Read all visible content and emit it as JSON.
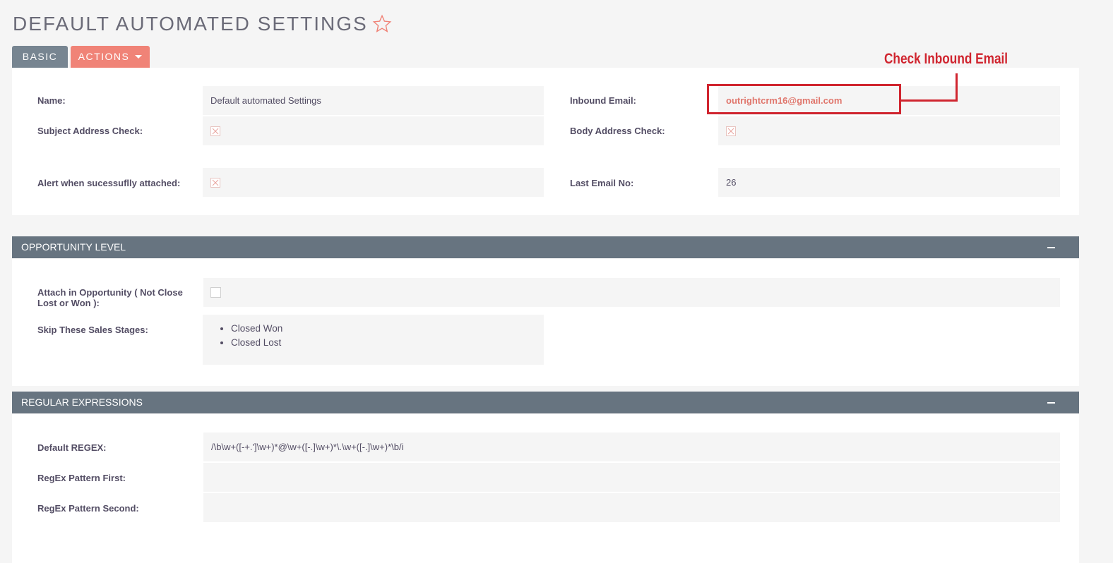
{
  "page": {
    "title": "DEFAULT AUTOMATED SETTINGS"
  },
  "tabs": {
    "basic": "BASIC",
    "actions": "ACTIONS"
  },
  "basic": {
    "name_label": "Name:",
    "name_value": "Default automated Settings",
    "inbound_email_label": "Inbound Email:",
    "inbound_email_value": "outrightcrm16@gmail.com",
    "subject_check_label": "Subject Address Check:",
    "body_check_label": "Body Address Check:",
    "alert_label": "Alert when sucessuflly attached:",
    "last_email_label": "Last Email No:",
    "last_email_value": "26"
  },
  "opportunity": {
    "header": "OPPORTUNITY LEVEL",
    "attach_label_line1": "Attach in Opportunity ( Not Close",
    "attach_label_line2": "Lost or Won ):",
    "skip_label": "Skip These Sales Stages:",
    "stages": [
      "Closed Won",
      "Closed Lost"
    ]
  },
  "regex": {
    "header": "REGULAR EXPRESSIONS",
    "default_label": "Default REGEX:",
    "default_value": "/\\b\\w+([-+.']\\w+)*@\\w+([-.]\\w+)*\\.\\w+([-.]\\w+)*\\b/i",
    "first_label": "RegEx Pattern First:",
    "first_value": "",
    "second_label": "RegEx Pattern Second:",
    "second_value": ""
  },
  "annotation": {
    "text": "Check Inbound Email",
    "color": "#d0252f"
  },
  "colors": {
    "accent": "#f08377",
    "header": "#677480",
    "tab_basic": "#778591"
  }
}
